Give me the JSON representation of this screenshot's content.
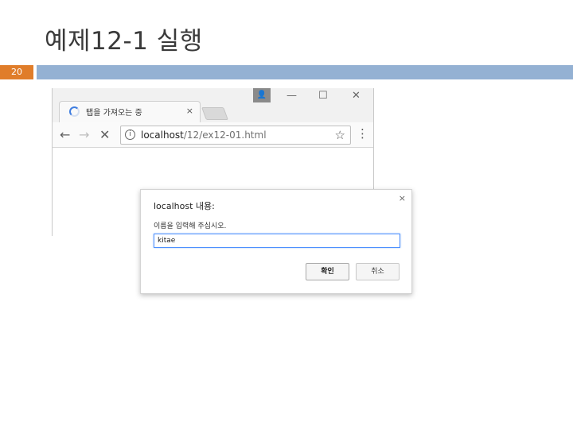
{
  "slide": {
    "title": "예제12-1 실행",
    "page_number": "20"
  },
  "browser": {
    "tab_title": "탭을 가져오는 중",
    "tab_close": "×",
    "url_host": "localhost",
    "url_path": "/12/ex12-01.html",
    "info": "i",
    "user_icon": "👤",
    "minimize": "—",
    "maximize": "☐",
    "close": "✕",
    "back": "←",
    "forward": "→",
    "stop": "✕",
    "star": "☆",
    "menu": "⋮"
  },
  "dialog": {
    "title": "localhost 내용:",
    "message": "이름을 입력해 주십시오.",
    "input_value": "kitae",
    "ok_label": "확인",
    "cancel_label": "취소",
    "close": "×"
  },
  "colors": {
    "header_bar": "#94b1d3",
    "page_badge": "#e07d2a",
    "focus_ring": "#4d90fe"
  }
}
